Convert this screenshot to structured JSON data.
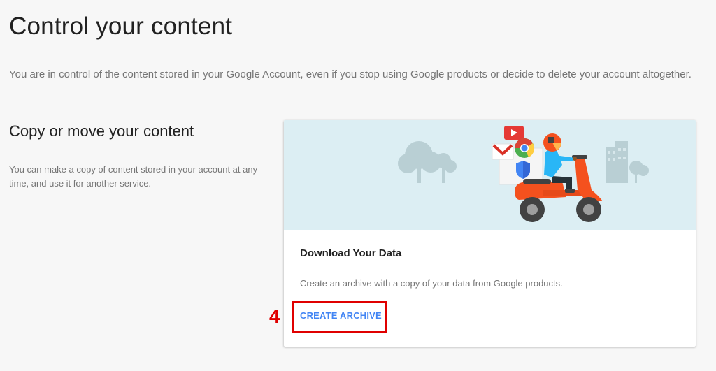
{
  "header": {
    "title": "Control your content",
    "intro": "You are in control of the content stored in your Google Account, even if you stop using Google products or decide to delete your account altogether."
  },
  "section": {
    "title": "Copy or move your content",
    "description": "You can make a copy of content stored in your account at any time, and use it for another service."
  },
  "card": {
    "title": "Download Your Data",
    "description": "Create an archive with a copy of your data from Google products.",
    "button_label": "CREATE ARCHIVE"
  },
  "annotation": {
    "step_number": "4",
    "color": "#e00000"
  },
  "colors": {
    "accent": "#4285f4",
    "hero_background": "#dceef3",
    "scooter": "#f4511e"
  },
  "illustration": {
    "icons": [
      "tree-icon",
      "building-icon",
      "youtube-icon",
      "gmail-icon",
      "chrome-icon",
      "shield-icon",
      "scooter-rider-icon"
    ]
  }
}
